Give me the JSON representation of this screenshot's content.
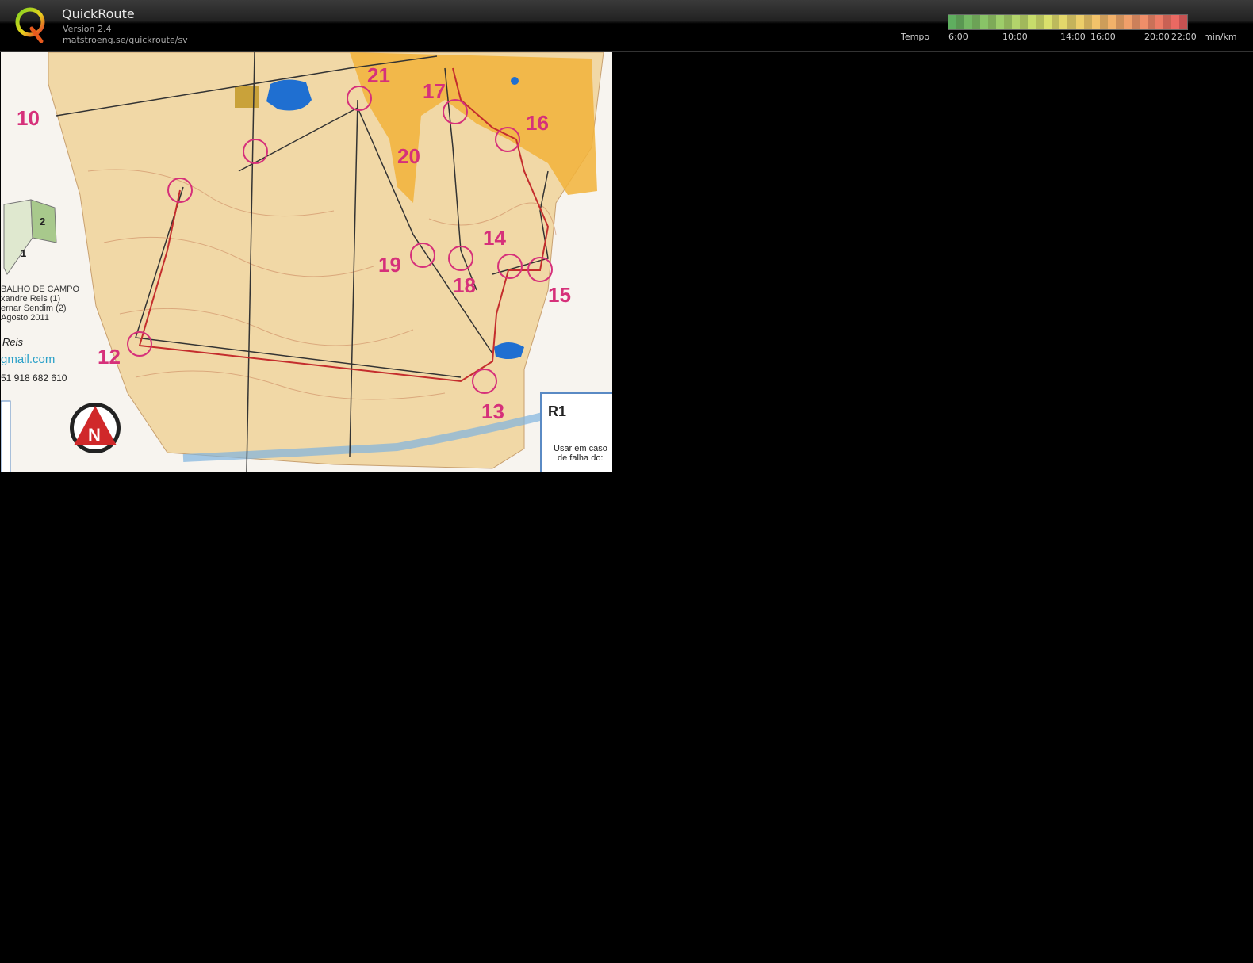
{
  "app": {
    "title": "QuickRoute",
    "version": "Version 2.4",
    "url": "matstroeng.se/quickroute/sv",
    "logo_icon": "quickroute-q-logo-icon"
  },
  "tempo": {
    "label": "Tempo",
    "unit": "min/km",
    "ticks": [
      "6:00",
      "10:00",
      "14:00",
      "16:00",
      "20:00",
      "22:00"
    ],
    "gradient_colors": [
      "#5fae5f",
      "#9ccc6a",
      "#d8e26c",
      "#f2c76a",
      "#f0956a",
      "#e86060"
    ]
  },
  "map": {
    "controls": [
      "10",
      "21",
      "17",
      "16",
      "20",
      "14",
      "19",
      "18",
      "15",
      "12",
      "13"
    ],
    "inset_labels": [
      "1",
      "2"
    ],
    "legend_lines": [
      "BALHO DE CAMPO",
      "xandre Reis (1)",
      "ernar Sendim (2)",
      "Agosto 2011"
    ],
    "author": "Reis",
    "email": "gmail.com",
    "phone": "51 918 682 610",
    "course": "R1",
    "backup_text": [
      "Usar em caso",
      "de falha do:"
    ],
    "north_letter": "N",
    "north_icon": "north-arrow-icon",
    "colors": {
      "control": "#d6307a",
      "water": "#1f6fd1",
      "open_land": "#f2b33a",
      "terrain": "#f1d8a6"
    }
  }
}
